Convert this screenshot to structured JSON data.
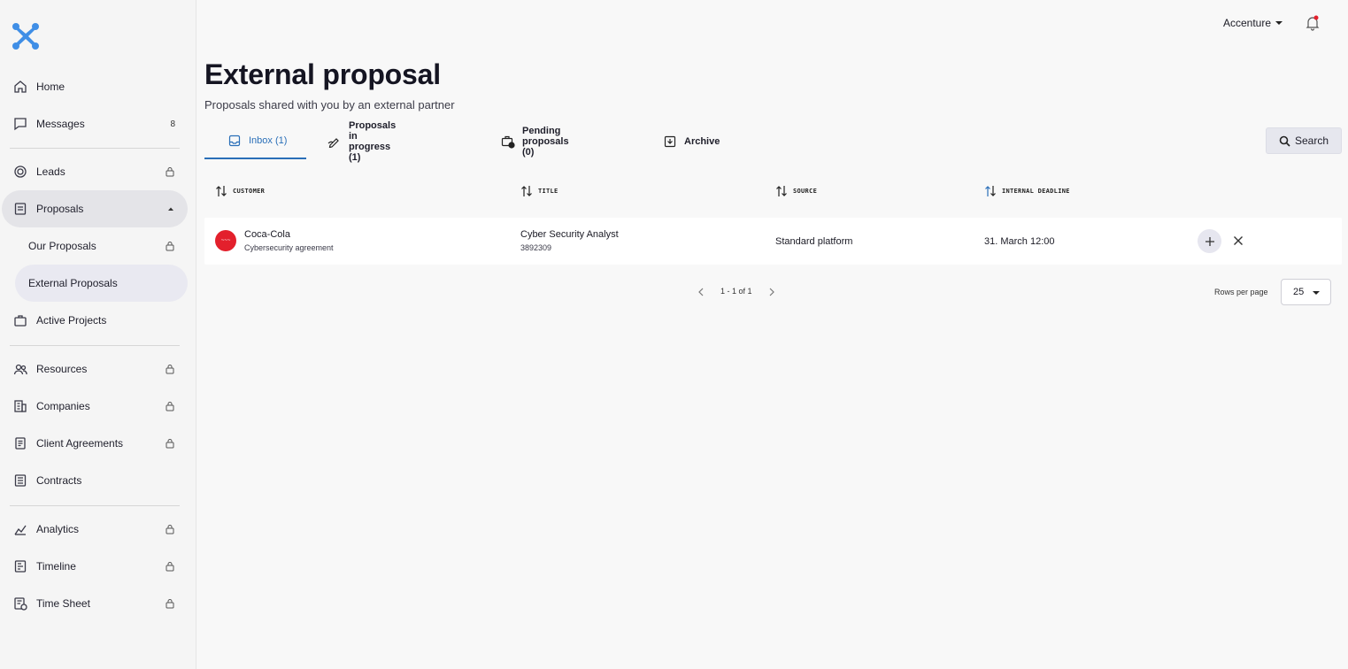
{
  "sidebar": {
    "items": [
      {
        "label": "Home",
        "icon": "home-icon"
      },
      {
        "label": "Messages",
        "icon": "message-icon",
        "badge": "8"
      },
      {
        "label": "Leads",
        "icon": "target-icon",
        "locked": true
      },
      {
        "label": "Proposals",
        "icon": "document-icon",
        "expanded": true
      },
      {
        "label": "Our Proposals",
        "locked": true
      },
      {
        "label": "External Proposals"
      },
      {
        "label": "Active Projects",
        "icon": "briefcase-icon"
      },
      {
        "label": "Resources",
        "icon": "people-icon",
        "locked": true
      },
      {
        "label": "Companies",
        "icon": "building-icon",
        "locked": true
      },
      {
        "label": "Client Agreements",
        "icon": "agreement-icon",
        "locked": true
      },
      {
        "label": "Contracts",
        "icon": "list-icon"
      },
      {
        "label": "Analytics",
        "icon": "chart-icon",
        "locked": true
      },
      {
        "label": "Timeline",
        "icon": "timeline-icon",
        "locked": true
      },
      {
        "label": "Time Sheet",
        "icon": "timesheet-icon",
        "locked": true
      }
    ]
  },
  "header": {
    "organization": "Accenture",
    "notification_dot_color": "#e3202c"
  },
  "page": {
    "title": "External proposal",
    "subtitle": "Proposals shared with you by an external partner"
  },
  "tabs": [
    {
      "label": "Inbox (1)",
      "active": true
    },
    {
      "label": "Proposals in progress (1)"
    },
    {
      "label": "Pending proposals (0)"
    },
    {
      "label": "Archive"
    }
  ],
  "search_label": "Search",
  "table": {
    "columns": [
      "CUSTOMER",
      "TITLE",
      "SOURCE",
      "INTERNAL DEADLINE"
    ],
    "rows": [
      {
        "customer": "Coca-Cola",
        "customer_sub": "Cybersecurity agreement",
        "title": "Cyber Security Analyst",
        "title_sub": "3892309",
        "source": "Standard platform",
        "deadline": "31. March 12:00"
      }
    ]
  },
  "pagination": {
    "range": "1 - 1 of 1",
    "rows_per_page_label": "Rows per page",
    "rows_per_page": "25"
  },
  "colors": {
    "accent": "#2a6fb8",
    "logo": "#3f8ee6",
    "brand_red": "#e3202c"
  }
}
